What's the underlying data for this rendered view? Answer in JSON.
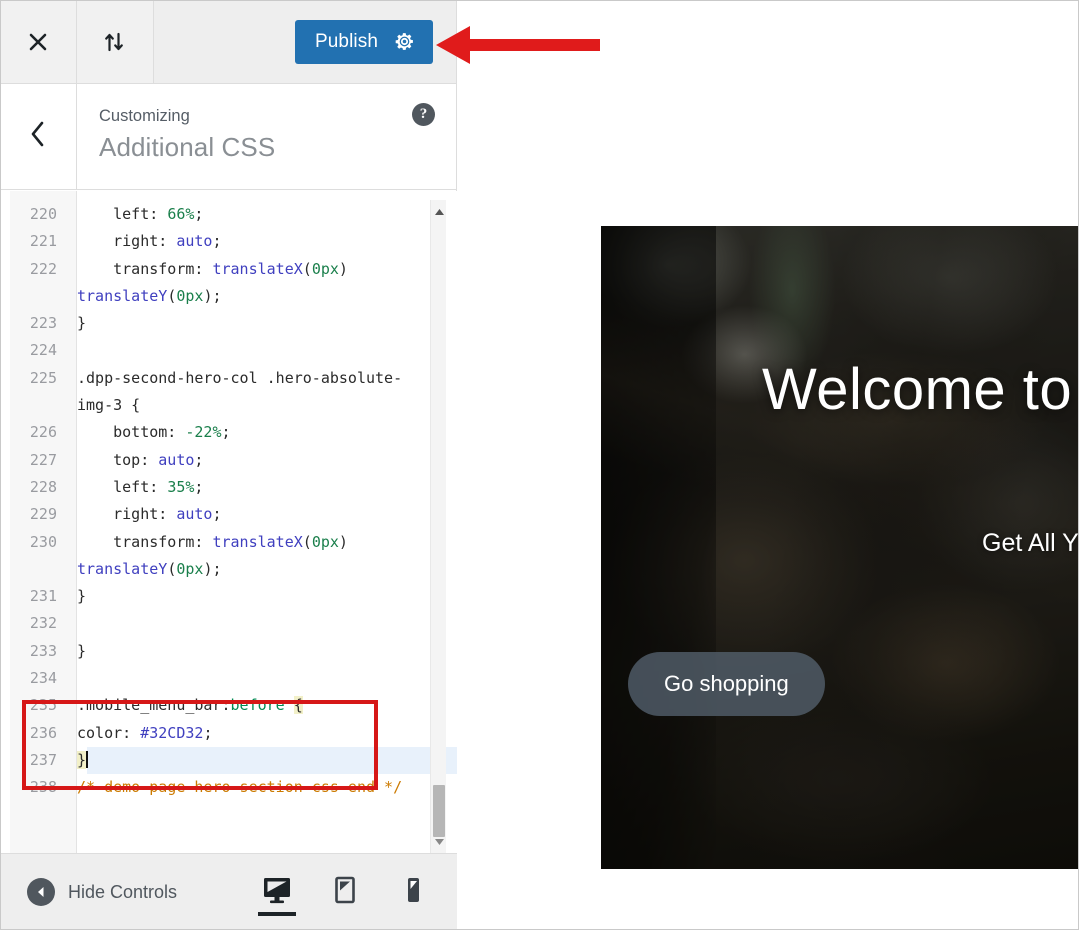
{
  "topbar": {
    "close_icon": "close-x-icon",
    "changeset_icon": "sort-arrows-icon",
    "publish_label": "Publish",
    "publish_gear_icon": "gear-icon",
    "publish_color": "#2271b1"
  },
  "panel_header": {
    "back_icon": "chevron-left-icon",
    "subtitle": "Customizing",
    "title": "Additional CSS",
    "help_icon": "help-question-icon",
    "help_glyph": "?"
  },
  "editor": {
    "lines": [
      {
        "num": "220",
        "segments": [
          {
            "t": "    left: ",
            "c": "tok-prop"
          },
          {
            "t": "66%",
            "c": "tok-num"
          },
          {
            "t": ";",
            "c": "tok-prop"
          }
        ]
      },
      {
        "num": "221",
        "segments": [
          {
            "t": "    right: ",
            "c": "tok-prop"
          },
          {
            "t": "auto",
            "c": "tok-kw"
          },
          {
            "t": ";",
            "c": "tok-prop"
          }
        ]
      },
      {
        "num": "222",
        "segments": [
          {
            "t": "    transform: ",
            "c": "tok-prop"
          },
          {
            "t": "translateX",
            "c": "tok-fn"
          },
          {
            "t": "(",
            "c": "tok-prop"
          },
          {
            "t": "0px",
            "c": "tok-num"
          },
          {
            "t": ") ",
            "c": "tok-prop"
          },
          {
            "t": "translateY",
            "c": "tok-fn"
          },
          {
            "t": "(",
            "c": "tok-prop"
          },
          {
            "t": "0px",
            "c": "tok-num"
          },
          {
            "t": ");",
            "c": "tok-prop"
          }
        ]
      },
      {
        "num": "223",
        "segments": [
          {
            "t": "}",
            "c": "tok-prop"
          }
        ]
      },
      {
        "num": "224",
        "segments": [
          {
            "t": "",
            "c": "tok-prop"
          }
        ]
      },
      {
        "num": "225",
        "segments": [
          {
            "t": ".dpp-second-hero-col .hero-absolute-img-3 {",
            "c": "tok-sel"
          }
        ]
      },
      {
        "num": "226",
        "segments": [
          {
            "t": "    bottom: ",
            "c": "tok-prop"
          },
          {
            "t": "-22%",
            "c": "tok-num"
          },
          {
            "t": ";",
            "c": "tok-prop"
          }
        ]
      },
      {
        "num": "227",
        "segments": [
          {
            "t": "    top: ",
            "c": "tok-prop"
          },
          {
            "t": "auto",
            "c": "tok-kw"
          },
          {
            "t": ";",
            "c": "tok-prop"
          }
        ]
      },
      {
        "num": "228",
        "segments": [
          {
            "t": "    left: ",
            "c": "tok-prop"
          },
          {
            "t": "35%",
            "c": "tok-num"
          },
          {
            "t": ";",
            "c": "tok-prop"
          }
        ]
      },
      {
        "num": "229",
        "segments": [
          {
            "t": "    right: ",
            "c": "tok-prop"
          },
          {
            "t": "auto",
            "c": "tok-kw"
          },
          {
            "t": ";",
            "c": "tok-prop"
          }
        ]
      },
      {
        "num": "230",
        "segments": [
          {
            "t": "    transform: ",
            "c": "tok-prop"
          },
          {
            "t": "translateX",
            "c": "tok-fn"
          },
          {
            "t": "(",
            "c": "tok-prop"
          },
          {
            "t": "0px",
            "c": "tok-num"
          },
          {
            "t": ") ",
            "c": "tok-prop"
          },
          {
            "t": "translateY",
            "c": "tok-fn"
          },
          {
            "t": "(",
            "c": "tok-prop"
          },
          {
            "t": "0px",
            "c": "tok-num"
          },
          {
            "t": ");",
            "c": "tok-prop"
          }
        ]
      },
      {
        "num": "231",
        "segments": [
          {
            "t": "}",
            "c": "tok-prop"
          }
        ]
      },
      {
        "num": "232",
        "segments": [
          {
            "t": "",
            "c": "tok-prop"
          }
        ]
      },
      {
        "num": "233",
        "segments": [
          {
            "t": "}",
            "c": "tok-prop"
          }
        ]
      },
      {
        "num": "234",
        "segments": [
          {
            "t": "",
            "c": "tok-prop"
          }
        ]
      },
      {
        "num": "235",
        "segments": [
          {
            "t": ".mobile_menu_bar:",
            "c": "tok-sel"
          },
          {
            "t": "before",
            "c": "tok-pseudo"
          },
          {
            "t": " ",
            "c": "tok-prop"
          },
          {
            "t": "{",
            "c": "tok-brace-match"
          }
        ]
      },
      {
        "num": "236",
        "segments": [
          {
            "t": "color: ",
            "c": "tok-prop"
          },
          {
            "t": "#32CD32",
            "c": "tok-kw"
          },
          {
            "t": ";",
            "c": "tok-prop"
          }
        ]
      },
      {
        "num": "237",
        "active": true,
        "caret": true,
        "segments": [
          {
            "t": "}",
            "c": "tok-brace-match"
          }
        ]
      },
      {
        "num": "238",
        "segments": [
          {
            "t": "/* demo page hero section css end */",
            "c": "tok-cmt"
          }
        ]
      }
    ],
    "scrollbar_up_icon": "scroll-up-arrow-icon",
    "scrollbar_down_icon": "scroll-down-arrow-icon",
    "annotation_box_color": "#d61717"
  },
  "bottom_bar": {
    "hide_controls_label": "Hide Controls",
    "hide_controls_icon": "collapse-left-arrow-icon",
    "devices": [
      {
        "name": "desktop",
        "icon": "desktop-preview-icon",
        "active": true
      },
      {
        "name": "tablet",
        "icon": "tablet-preview-icon",
        "active": false
      },
      {
        "name": "mobile",
        "icon": "mobile-preview-icon",
        "active": false
      }
    ]
  },
  "preview": {
    "hero_title": "Welcome to",
    "hero_subtitle": "Get All Y",
    "cta_label": "Go shopping"
  },
  "annotation": {
    "arrow_icon": "red-left-arrow-annotation",
    "arrow_color": "#e01b1b"
  }
}
